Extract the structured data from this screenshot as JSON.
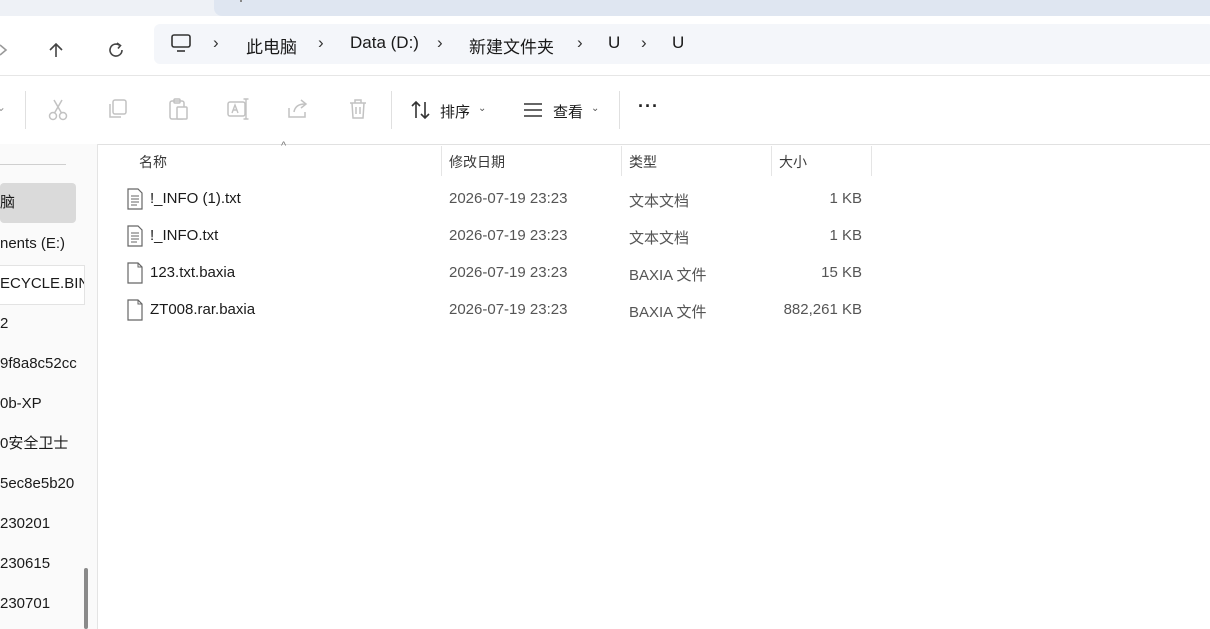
{
  "breadcrumb": [
    "此电脑",
    "Data (D:)",
    "新建文件夹",
    "U",
    "U"
  ],
  "toolbar": {
    "sort_label": "排序",
    "view_label": "查看",
    "more_label": "···"
  },
  "sidebar": {
    "items": [
      "脑",
      "nents (E:)",
      "ECYCLE.BIN",
      "2",
      "9f8a8c52cc",
      "0b-XP",
      "0安全卫士",
      "5ec8e5b20",
      "230201",
      "230615",
      "230701"
    ]
  },
  "columns": {
    "name": "名称",
    "modified": "修改日期",
    "type": "类型",
    "size": "大小"
  },
  "files": [
    {
      "name": "!_INFO (1).txt",
      "modified": "2026-07-19 23:23",
      "type": "文本文档",
      "size": "1 KB",
      "icon": "text-file-icon"
    },
    {
      "name": "!_INFO.txt",
      "modified": "2026-07-19 23:23",
      "type": "文本文档",
      "size": "1 KB",
      "icon": "text-file-icon"
    },
    {
      "name": "123.txt.baxia",
      "modified": "2026-07-19 23:23",
      "type": "BAXIA 文件",
      "size": "15 KB",
      "icon": "blank-file-icon"
    },
    {
      "name": "ZT008.rar.baxia",
      "modified": "2026-07-19 23:23",
      "type": "BAXIA 文件",
      "size": "882,261 KB",
      "icon": "blank-file-icon"
    }
  ]
}
